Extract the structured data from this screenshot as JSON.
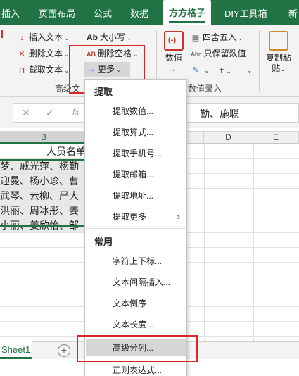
{
  "tabs": [
    "插入",
    "页面布局",
    "公式",
    "数据",
    "方方格子",
    "DIY工具箱",
    "新"
  ],
  "active_tab": "方方格子",
  "ribbon": {
    "insert_text": "插入文本",
    "delete_text": "删除文本",
    "cut_text": "截取文本",
    "case": "大小写",
    "delete_space": "删除空格",
    "more": "更多",
    "group_text_label": "高级文",
    "values_label": "数值",
    "round": "四舍五入",
    "keep_value": "只保留数值",
    "group_numeric_label": "数值录入",
    "copy_paste_1": "复制粘",
    "copy_paste_2": "贴",
    "case_icon_text": "Ab",
    "space_icon_text": "AB",
    "abc_icon_text": "Abc"
  },
  "formula_bar": {
    "value": "勤、施聪",
    "fx": "fx"
  },
  "columns": [
    "B",
    "D",
    "E"
  ],
  "rows": [
    {
      "text": "人员名单"
    },
    {
      "text": "梦、戚光萍、杨勤"
    },
    {
      "text": "迎曼、杨小珍、曹"
    },
    {
      "text": "武琴、云柳、严大"
    },
    {
      "text": "洪丽、周冰彤、姜"
    },
    {
      "text": "小丽、姜欣怡、邹"
    }
  ],
  "sheet_tab": "Sheet1",
  "menu": {
    "header_extract": "提取",
    "extract_items": [
      "提取数值...",
      "提取算式...",
      "提取手机号...",
      "提取邮箱...",
      "提取地址...",
      "提取更多"
    ],
    "header_common": "常用",
    "common_items": [
      "字符上下标...",
      "文本间隔插入...",
      "文本倒序",
      "文本长度...",
      "高级分列...",
      "正则表达式..."
    ]
  },
  "colors": {
    "accent_green": "#217346",
    "highlight_red": "#d9262c"
  }
}
